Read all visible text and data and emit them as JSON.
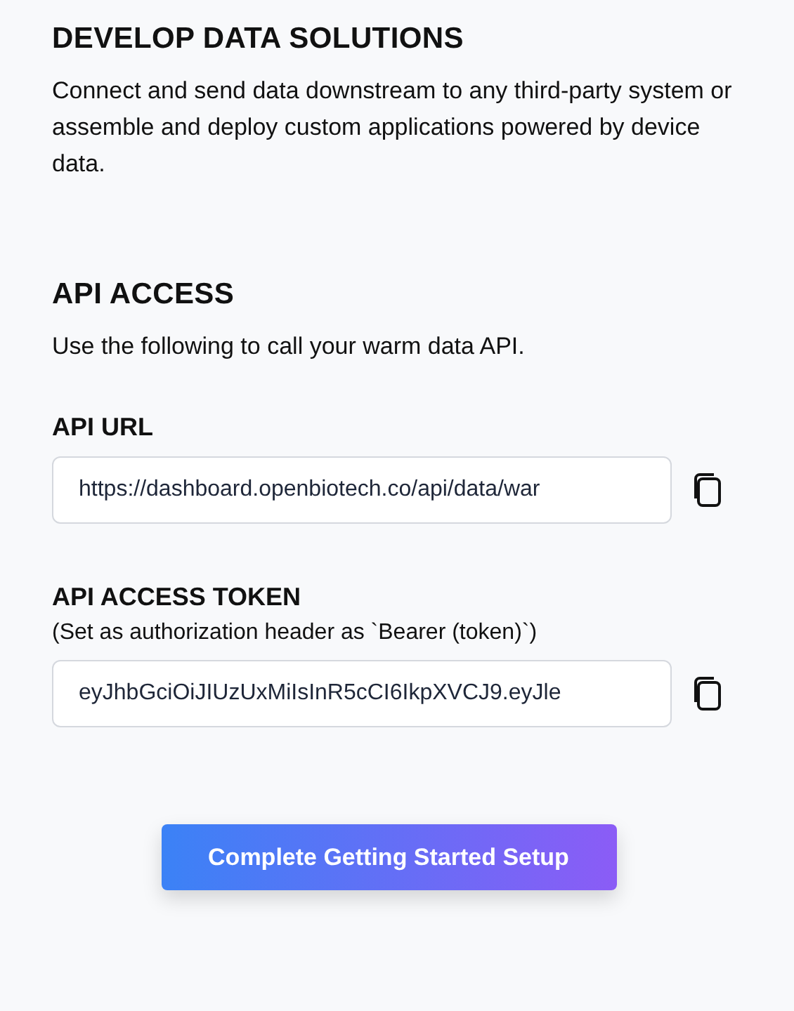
{
  "develop": {
    "heading": "DEVELOP DATA SOLUTIONS",
    "description": "Connect and send data downstream to any third-party system or assemble and deploy custom applications powered by device data."
  },
  "api_access": {
    "heading": "API ACCESS",
    "description": "Use the following to call your warm data API."
  },
  "fields": [
    {
      "label": "API URL",
      "value": "https://dashboard.openbiotech.co/api/data/war"
    },
    {
      "label": "API ACCESS TOKEN",
      "hint": "(Set as authorization header as `Bearer (token)`)",
      "value": "eyJhbGciOiJIUzUxMiIsInR5cCI6IkpXVCJ9.eyJle"
    }
  ],
  "button": {
    "label": "Complete Getting Started Setup"
  }
}
